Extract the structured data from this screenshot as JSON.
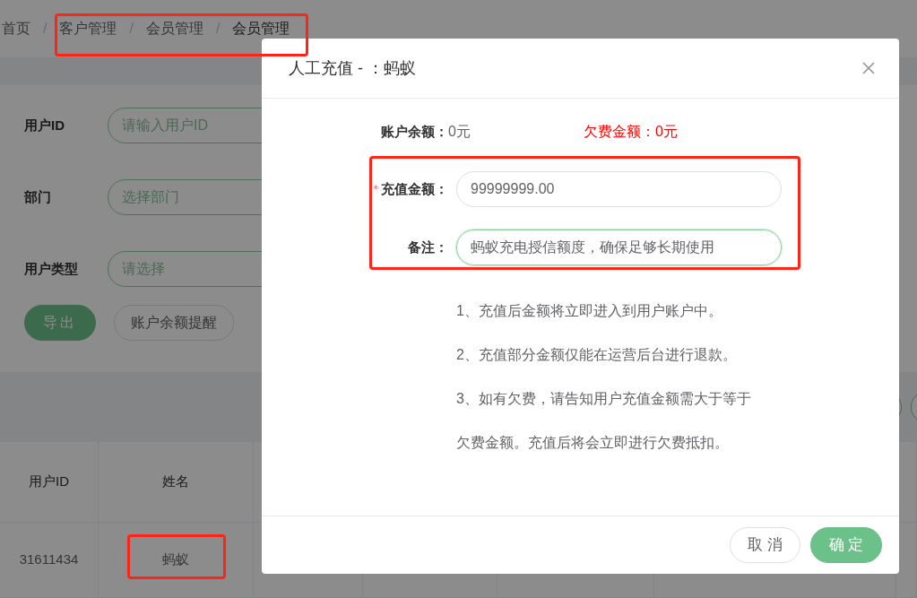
{
  "breadcrumb": {
    "items": [
      "首页",
      "客户管理",
      "会员管理",
      "会员管理"
    ],
    "separators": [
      "/",
      "/",
      "/"
    ]
  },
  "filters": [
    {
      "label": "用户ID",
      "placeholder": "请输入用户ID"
    },
    {
      "label": "部门",
      "placeholder": "选择部门"
    },
    {
      "label": "用户类型",
      "placeholder": "请选择"
    }
  ],
  "actions": [
    {
      "label": "导出",
      "kind": "primary"
    },
    {
      "label": "账户余额提醒",
      "kind": "outline"
    }
  ],
  "table": {
    "columns": [
      "用户ID",
      "姓名"
    ],
    "rows": [
      [
        "31611434",
        "蚂蚁"
      ]
    ]
  },
  "dialog": {
    "title": "人工充值 - ：蚂蚁",
    "balance_label": "账户余额：",
    "balance_value": "0元",
    "arrears": "欠费金额：0元",
    "required_mark": "*",
    "fields": [
      {
        "label": "充值金额：",
        "required": true,
        "value": "99999999.00",
        "focused": false
      },
      {
        "label": "备注：",
        "required": false,
        "value": "蚂蚁充电授信额度，确保足够长期使用",
        "focused": true
      }
    ],
    "notes": [
      "1、充值后金额将立即进入到用户账户中。",
      "2、充值部分金额仅能在运营后台进行退款。",
      "3、如有欠费，请告知用户充值金额需大于等于",
      "欠费金额。充值后将会立即进行欠费抵扣。"
    ],
    "buttons": [
      {
        "label": "取消",
        "kind": "default"
      },
      {
        "label": "确定",
        "kind": "primary"
      }
    ]
  }
}
